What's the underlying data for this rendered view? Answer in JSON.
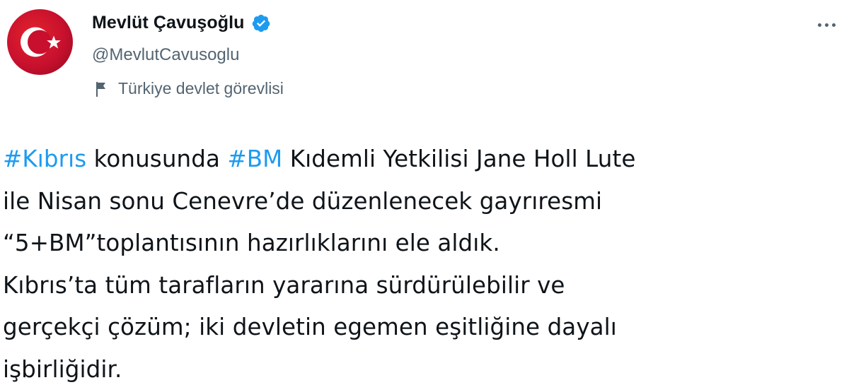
{
  "author": {
    "display_name": "Mevlüt Çavuşoğlu",
    "handle": "@MevlutCavusoglu",
    "label": "Türkiye devlet görevlisi",
    "avatar_icon": "turkish-flag-crescent-star-icon",
    "verified_icon": "verified-badge-icon",
    "label_icon": "flag-icon"
  },
  "menu": {
    "more_icon": "more-options-icon"
  },
  "colors": {
    "hashtag": "#1d9bf0",
    "text": "#0f1419",
    "secondary": "#536471",
    "verified": "#1d9bf0",
    "avatar_red": "#c8102e"
  },
  "tweet": {
    "line1": {
      "hashtag1": "#Kıbrıs",
      "text1": " konusunda ",
      "hashtag2": "#BM",
      "text2": " Kıdemli Yetkilisi Jane Holl Lute"
    },
    "line2": "ile Nisan sonu Cenevre’de düzenlenecek gayrıresmi",
    "line3": "“5+BM”toplantısının hazırlıklarını ele aldık.",
    "line4": "Kıbrıs’ta tüm tarafların yararına sürdürülebilir ve",
    "line5": "gerçekçi çözüm; iki devletin egemen eşitliğine dayalı",
    "line6": "işbirliğidir."
  }
}
